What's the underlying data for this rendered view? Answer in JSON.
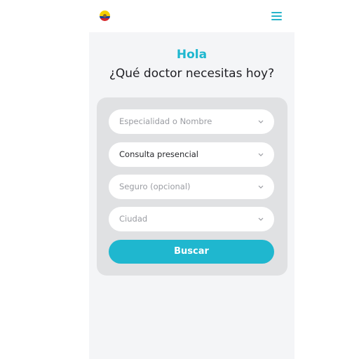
{
  "header": {
    "country_flag_icon": "ecuador-flag-icon",
    "menu_icon": "hamburger-menu-icon",
    "accent_color": "#26b3c9"
  },
  "hero": {
    "greeting": "Hola",
    "title": "¿Qué doctor necesitas hoy?"
  },
  "search_form": {
    "specialty": {
      "placeholder": "Especialidad o Nombre",
      "value": ""
    },
    "consultation_type": {
      "value": "Consulta presencial"
    },
    "insurance": {
      "placeholder": "Seguro (opcional)",
      "value": ""
    },
    "city": {
      "placeholder": "Ciudad",
      "value": ""
    },
    "submit_label": "Buscar",
    "button_color": "#1fb7cf"
  }
}
